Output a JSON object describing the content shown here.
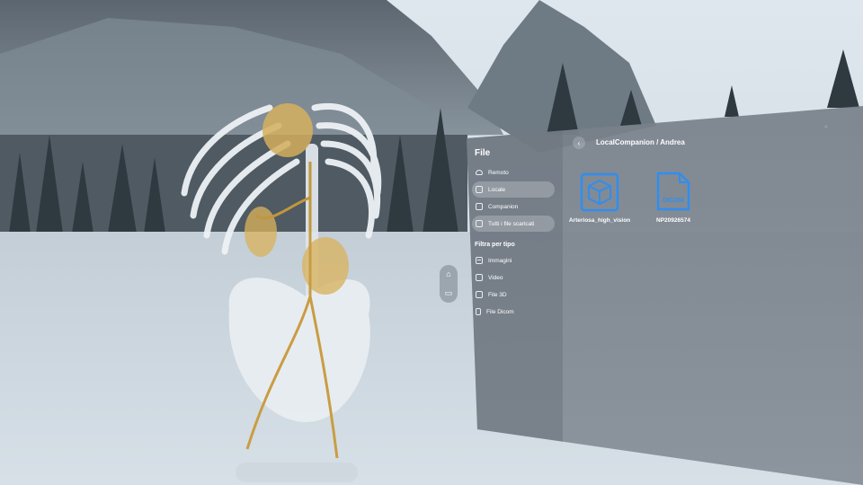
{
  "window": {
    "title": "File"
  },
  "sidebar": {
    "items": [
      {
        "label": "Remoto",
        "icon": "cloud-icon",
        "active": false
      },
      {
        "label": "Locale",
        "icon": "storage-icon",
        "active": true
      },
      {
        "label": "Companion",
        "icon": "companion-icon",
        "active": false
      },
      {
        "label": "Tutti i file scaricati",
        "icon": "book-icon",
        "active": false
      }
    ],
    "filter_section_label": "Filtra per tipo",
    "filters": [
      {
        "label": "Immagini",
        "icon": "image-icon"
      },
      {
        "label": "Video",
        "icon": "video-icon"
      },
      {
        "label": "File 3D",
        "icon": "cube-icon"
      },
      {
        "label": "File Dicom",
        "icon": "document-icon"
      }
    ]
  },
  "content": {
    "path": "LocalCompanion / Andrea",
    "files": [
      {
        "name": "Arteriosa_high_vision",
        "type": "3d-model-file-icon"
      },
      {
        "name": "NP20926574",
        "type": "dicom-file-icon",
        "badge": "DICOM"
      }
    ]
  },
  "colors": {
    "accent": "#2f8ef0"
  }
}
